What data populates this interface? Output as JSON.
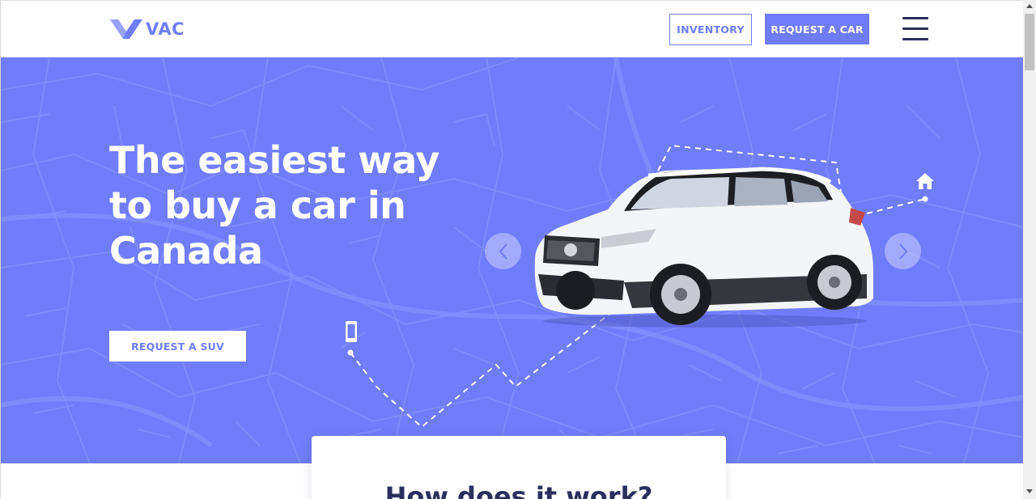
{
  "header": {
    "logo_text": "VAC",
    "inventory_label": "INVENTORY",
    "request_car_label": "REQUEST A CAR",
    "menu_icon": "hamburger-menu-icon"
  },
  "hero": {
    "title_line1": "The easiest way",
    "title_line2": "to buy a car in",
    "title_line3": "Canada",
    "cta_label": "REQUEST A SUV",
    "prev_icon": "chevron-left-icon",
    "next_icon": "chevron-right-icon",
    "home_icon": "home-icon",
    "phone_icon": "smartphone-icon"
  },
  "how_it_works": {
    "title": "How does it work?"
  },
  "colors": {
    "accent": "#6f7dfb",
    "navy": "#2b2f5d",
    "white": "#ffffff"
  }
}
